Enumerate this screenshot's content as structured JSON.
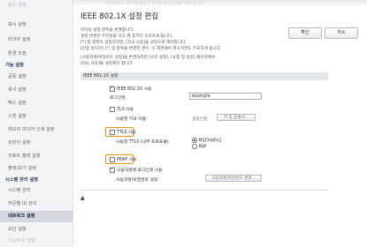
{
  "header": {
    "breadcrumb": "설정/등록 > 네트워크 설정 > TCP/IP 설정 > IEEE 802.1X 설정"
  },
  "sidebar": {
    "items": [
      {
        "label": "용지 설정",
        "state": "faded"
      },
      {
        "label": "표시 설정",
        "state": "normal"
      },
      {
        "label": "타이머 설정",
        "state": "normal"
      },
      {
        "label": "환경 조정",
        "state": "normal"
      },
      {
        "label": "기능 설정",
        "state": "group"
      },
      {
        "label": "공통 설정",
        "state": "normal"
      },
      {
        "label": "복사 설정",
        "state": "normal"
      },
      {
        "label": "팩스 설정",
        "state": "normal"
      },
      {
        "label": "스캔 설정",
        "state": "normal"
      },
      {
        "label": "메모리 미디어 인쇄 설정",
        "state": "normal"
      },
      {
        "label": "프린터 설정",
        "state": "normal"
      },
      {
        "label": "리포트 출력 설정",
        "state": "normal"
      },
      {
        "label": "출력/보기 설정",
        "state": "normal"
      },
      {
        "label": "시스템 관리 설정",
        "state": "group"
      },
      {
        "label": "시스템 관리",
        "state": "normal"
      },
      {
        "label": "부문별 ID 관리",
        "state": "normal"
      },
      {
        "label": "네트워크 설정",
        "state": "active"
      },
      {
        "label": "보안 설정",
        "state": "normal"
      },
      {
        "label": "리모트UI 설정",
        "state": "faded"
      }
    ]
  },
  "page": {
    "title": "IEEE 802.1X 설정 편집"
  },
  "buttons": {
    "ok": "확인",
    "cancel": "취소"
  },
  "notice": {
    "lines": [
      "이하의 설정 항목을 변경합니다.",
      "설정 변경은 주전원을 끄고 켠 후부터 유효하게 됩니다.",
      "[*] 및 항목이 설정하려면, [TLS 사용]을 설정으로 해야합니다.",
      "[인증 방식]이 [*] 및 항목을 변경한 경우, 이 화면에서 취소하면도 무효하게 됩니다.",
      "[사용자명/비밀번호 설정]을 변경하려면 [보안 설정], [요청 및 설정] 페이지에서",
      "[SSL 사용]을 설정해야 합니다."
    ]
  },
  "section": {
    "header": "IEEE 802.1X 설정"
  },
  "form": {
    "ieee_use": {
      "label": "IEEE 802.1X 사용",
      "checked": true
    },
    "login_name": {
      "label": "로그인명:",
      "value": "example"
    },
    "tls_use": {
      "label": "TLS 사용",
      "checked": false
    },
    "tls_key": {
      "label": "사용할 키의 이름:",
      "value": "설정안함",
      "button": "키 및 증명서..."
    },
    "ttls_use": {
      "label": "TTLS 사용",
      "checked": false
    },
    "ttls_inner": {
      "label": "사용할 TTLS (내부 프로토콜):",
      "options": [
        {
          "label": "MSCHAPv2",
          "selected": true
        },
        {
          "label": "PAP",
          "selected": false
        }
      ]
    },
    "peap_use": {
      "label": "PEAP 사용",
      "checked": false
    },
    "same_user": {
      "label": "사용자명에 로그인명 사용",
      "checked": true
    },
    "userpass": {
      "label": "사용자명/비밀번호 설정:",
      "button": "사용자명/비밀번호 변경..."
    }
  },
  "footer": {
    "mark": "▲"
  },
  "colors": {
    "highlight": "#f0900f",
    "active_item": "#d4d8de"
  }
}
